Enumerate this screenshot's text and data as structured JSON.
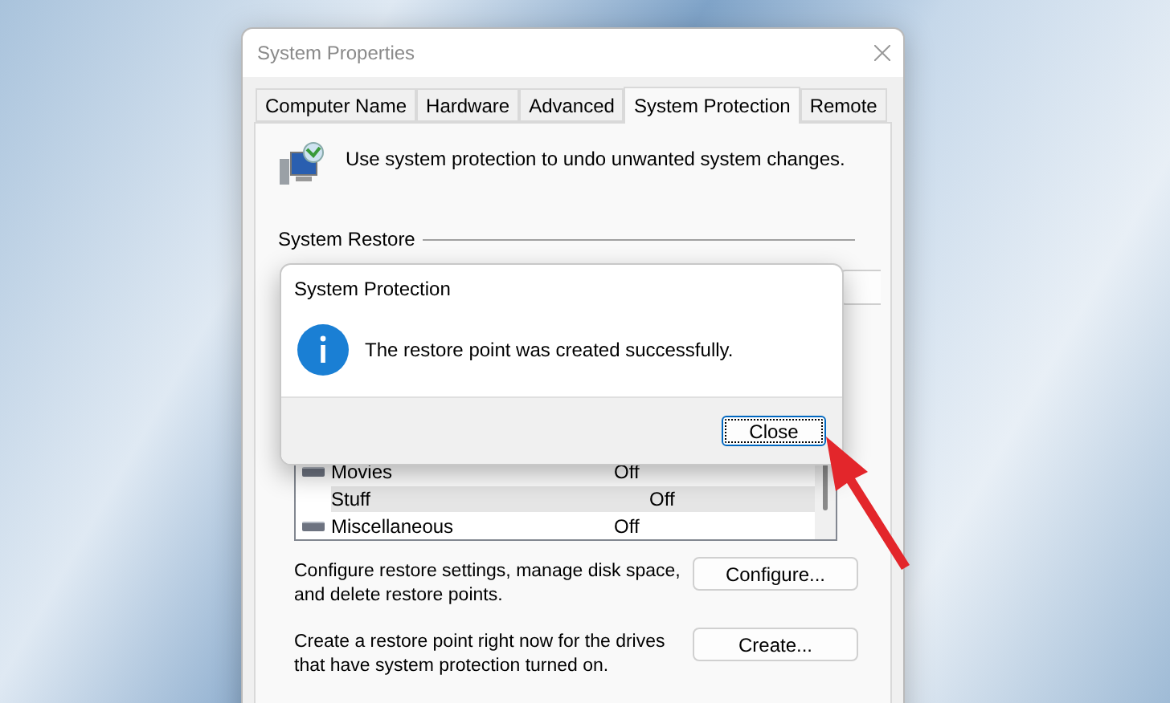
{
  "window": {
    "title": "System Properties"
  },
  "tabs": [
    {
      "label": "Computer Name",
      "selected": false
    },
    {
      "label": "Hardware",
      "selected": false
    },
    {
      "label": "Advanced",
      "selected": false
    },
    {
      "label": "System Protection",
      "selected": true
    },
    {
      "label": "Remote",
      "selected": false
    }
  ],
  "description": "Use system protection to undo unwanted system changes.",
  "system_restore": {
    "heading": "System Restore"
  },
  "drives": [
    {
      "name": "Movies",
      "protection": "Off",
      "selected": false
    },
    {
      "name": "Stuff",
      "protection": "Off",
      "selected": true
    },
    {
      "name": "Miscellaneous",
      "protection": "Off",
      "selected": false
    }
  ],
  "configure": {
    "text": "Configure restore settings, manage disk space, and delete restore points.",
    "button": "Configure..."
  },
  "create": {
    "text": "Create a restore point right now for the drives that have system protection turned on.",
    "button": "Create..."
  },
  "dialog": {
    "title": "System Protection",
    "message": "The restore point was created successfully.",
    "button": "Close",
    "focused": true
  }
}
